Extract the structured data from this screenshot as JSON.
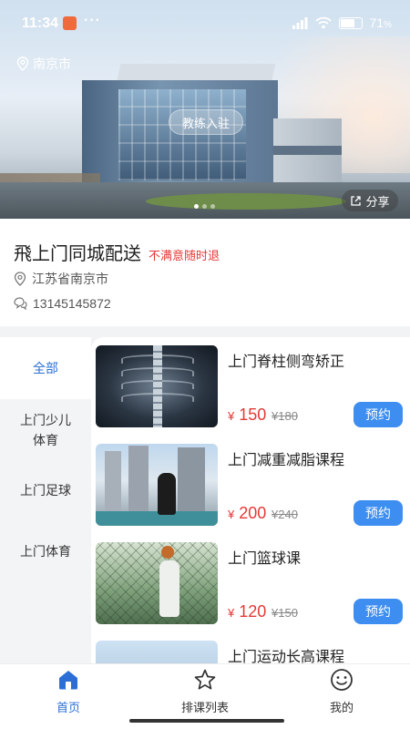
{
  "status_bar": {
    "time": "11:34",
    "more": "···",
    "battery": "71",
    "battery_unit": "%",
    "battery_level": 0.71
  },
  "hero": {
    "location": "南京市",
    "coach_button": "教练入驻",
    "share_button": "分享",
    "carousel_total": 3,
    "carousel_active": 0
  },
  "store": {
    "name": "飛上门同城配送",
    "tag": "不满意随时退",
    "address": "江苏省南京市",
    "phone": "13145145872"
  },
  "categories": [
    {
      "label": "全部",
      "active": true
    },
    {
      "label": "上门少儿体育",
      "active": false
    },
    {
      "label": "上门足球",
      "active": false
    },
    {
      "label": "上门体育",
      "active": false
    }
  ],
  "courses": [
    {
      "name": "上门脊柱侧弯矫正",
      "price": "150",
      "original": "¥180",
      "book": "预约",
      "image": "xray"
    },
    {
      "name": "上门减重减脂课程",
      "price": "200",
      "original": "¥240",
      "book": "预约",
      "image": "city-court"
    },
    {
      "name": "上门篮球课",
      "price": "120",
      "original": "¥150",
      "book": "预约",
      "image": "basketball"
    },
    {
      "name": "上门运动长高课程",
      "price": "",
      "original": "",
      "book": "",
      "image": "kids"
    }
  ],
  "currency": "¥",
  "tabbar": [
    {
      "label": "首页",
      "icon": "home-icon",
      "active": true
    },
    {
      "label": "排课列表",
      "icon": "star-icon",
      "active": false
    },
    {
      "label": "我的",
      "icon": "smile-icon",
      "active": false
    }
  ],
  "colors": {
    "accent": "#2b6fd6",
    "price": "#e53935",
    "book_button": "#3d8ef0"
  }
}
